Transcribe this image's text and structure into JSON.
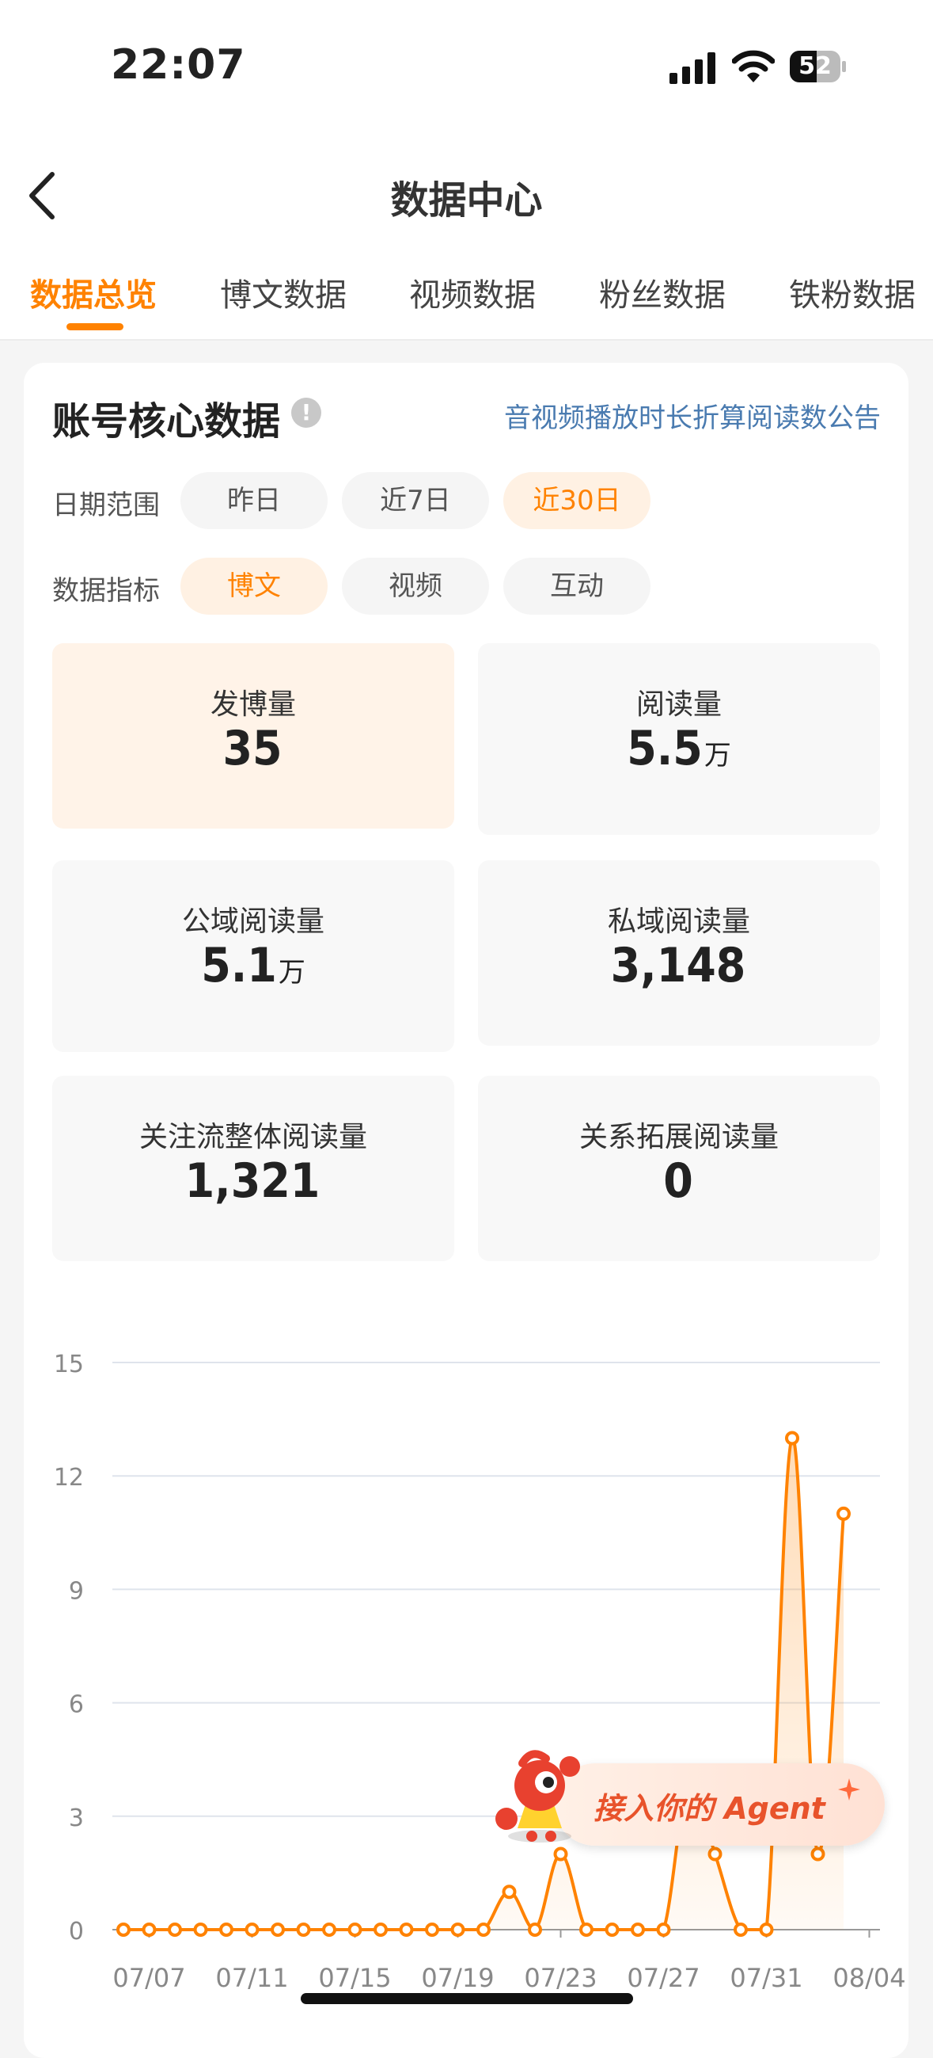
{
  "status_bar": {
    "time": "22:07",
    "battery": "52"
  },
  "nav": {
    "title": "数据中心"
  },
  "tabs": [
    {
      "label": "数据总览",
      "active": true
    },
    {
      "label": "博文数据",
      "active": false
    },
    {
      "label": "视频数据",
      "active": false
    },
    {
      "label": "粉丝数据",
      "active": false
    },
    {
      "label": "铁粉数据",
      "active": false
    }
  ],
  "section": {
    "title": "账号核心数据",
    "info_icon": "!",
    "notice_link": "音视频播放时长折算阅读数公告"
  },
  "filters": {
    "date_range": {
      "label": "日期范围",
      "options": [
        "昨日",
        "近7日",
        "近30日"
      ],
      "selected": "近30日"
    },
    "metric_type": {
      "label": "数据指标",
      "options": [
        "博文",
        "视频",
        "互动"
      ],
      "selected": "博文"
    }
  },
  "metrics": [
    {
      "label": "发博量",
      "value": "35",
      "unit": ""
    },
    {
      "label": "阅读量",
      "value": "5.5",
      "unit": "万"
    },
    {
      "label": "公域阅读量",
      "value": "5.1",
      "unit": "万"
    },
    {
      "label": "私域阅读量",
      "value": "3,148",
      "unit": ""
    },
    {
      "label": "关注流整体阅读量",
      "value": "1,321",
      "unit": ""
    },
    {
      "label": "关系拓展阅读量",
      "value": "0",
      "unit": ""
    }
  ],
  "agent_button": {
    "label": "接入你的 Agent"
  },
  "colors": {
    "accent": "#ff8200",
    "link": "#4a7bb0",
    "agent_text": "#e8532b"
  },
  "chart_data": {
    "type": "line",
    "x": [
      "07/06",
      "07/07",
      "07/08",
      "07/09",
      "07/10",
      "07/11",
      "07/12",
      "07/13",
      "07/14",
      "07/15",
      "07/16",
      "07/17",
      "07/18",
      "07/19",
      "07/20",
      "07/21",
      "07/22",
      "07/23",
      "07/24",
      "07/25",
      "07/26",
      "07/27",
      "07/28",
      "07/29",
      "07/30",
      "07/31",
      "08/01",
      "08/02",
      "08/03",
      "08/04",
      "08/05"
    ],
    "tick_labels": [
      "07/07",
      "07/11",
      "07/15",
      "07/19",
      "07/23",
      "07/27",
      "07/31",
      "08/04"
    ],
    "series": [
      {
        "values": [
          0,
          0,
          0,
          0,
          0,
          0,
          0,
          0,
          0,
          0,
          0,
          0,
          0,
          0,
          0,
          1,
          0,
          2,
          0,
          0,
          0,
          0,
          4,
          2,
          0,
          0,
          13,
          2,
          11
        ]
      }
    ],
    "y_ticks": [
      0,
      3,
      6,
      9,
      12,
      15
    ],
    "ylim": [
      0,
      15
    ],
    "grid": true,
    "title": "",
    "xlabel": "",
    "ylabel": ""
  }
}
